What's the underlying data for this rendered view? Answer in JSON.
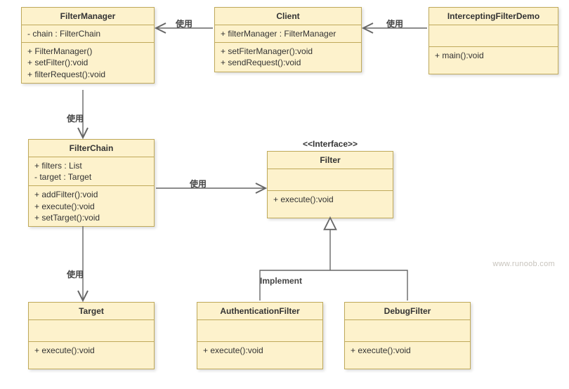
{
  "stereotype_filter": "<<Interface>>",
  "classes": {
    "FilterManager": {
      "name": "FilterManager",
      "attrs": [
        "- chain : FilterChain"
      ],
      "ops": [
        "+ FilterManager()",
        "+ setFilter():void",
        "+ filterRequest():void"
      ]
    },
    "Client": {
      "name": "Client",
      "attrs": [
        "+ filterManager : FilterManager"
      ],
      "ops": [
        "+ setFiterManager():void",
        "+ sendRequest():void"
      ]
    },
    "InterceptingFilterDemo": {
      "name": "InterceptingFilterDemo",
      "attrs": [
        ""
      ],
      "ops": [
        "+ main():void"
      ]
    },
    "FilterChain": {
      "name": "FilterChain",
      "attrs": [
        "+ filters : List",
        "- target : Target"
      ],
      "ops": [
        "+ addFilter():void",
        "+ execute():void",
        "+ setTarget():void"
      ]
    },
    "Filter": {
      "name": "Filter",
      "attrs": [
        ""
      ],
      "ops": [
        "+ execute():void"
      ]
    },
    "Target": {
      "name": "Target",
      "attrs": [
        ""
      ],
      "ops": [
        "+ execute():void"
      ]
    },
    "AuthenticationFilter": {
      "name": "AuthenticationFilter",
      "attrs": [
        ""
      ],
      "ops": [
        "+ execute():void"
      ]
    },
    "DebugFilter": {
      "name": "DebugFilter",
      "attrs": [
        ""
      ],
      "ops": [
        "+ execute():void"
      ]
    }
  },
  "edges": {
    "client_uses_filtermanager": "使用",
    "demo_uses_client": "使用",
    "filtermanager_uses_filterchain": "使用",
    "filterchain_uses_filter": "使用",
    "filterchain_uses_target": "使用",
    "implement": "Implement"
  },
  "watermark": "www.runoob.com"
}
